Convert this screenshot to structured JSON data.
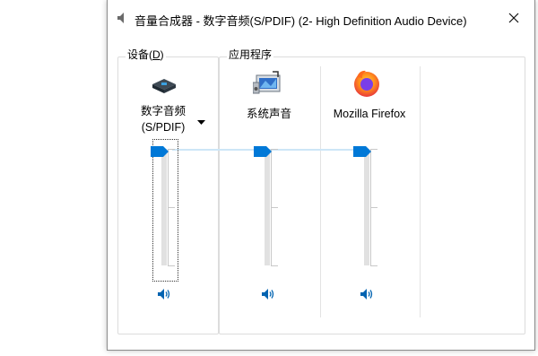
{
  "window": {
    "title": "音量合成器 - 数字音频(S/PDIF) (2- High Definition Audio Device)",
    "title_icon": "speaker-icon",
    "close_icon": "close-icon"
  },
  "groups": {
    "device_label": "设备(D)",
    "device_accel_prefix": "设备(",
    "device_accel_key": "D",
    "device_accel_suffix": ")",
    "apps_label": "应用程序"
  },
  "device": {
    "name_line1": "数字音频",
    "name_line2": "(S/PDIF)",
    "icon": "spdif-device-icon",
    "volume": 1.0,
    "mute_icon": "speaker-volume-icon"
  },
  "apps": [
    {
      "name": "系统声音",
      "icon": "system-sounds-icon",
      "volume": 1.0,
      "mute_icon": "speaker-volume-icon"
    },
    {
      "name": "Mozilla Firefox",
      "icon": "firefox-icon",
      "volume": 1.0,
      "mute_icon": "speaker-volume-icon"
    }
  ],
  "colors": {
    "accent": "#0078d7",
    "track": "#e1e1e1",
    "peak": "#cde6f7"
  }
}
